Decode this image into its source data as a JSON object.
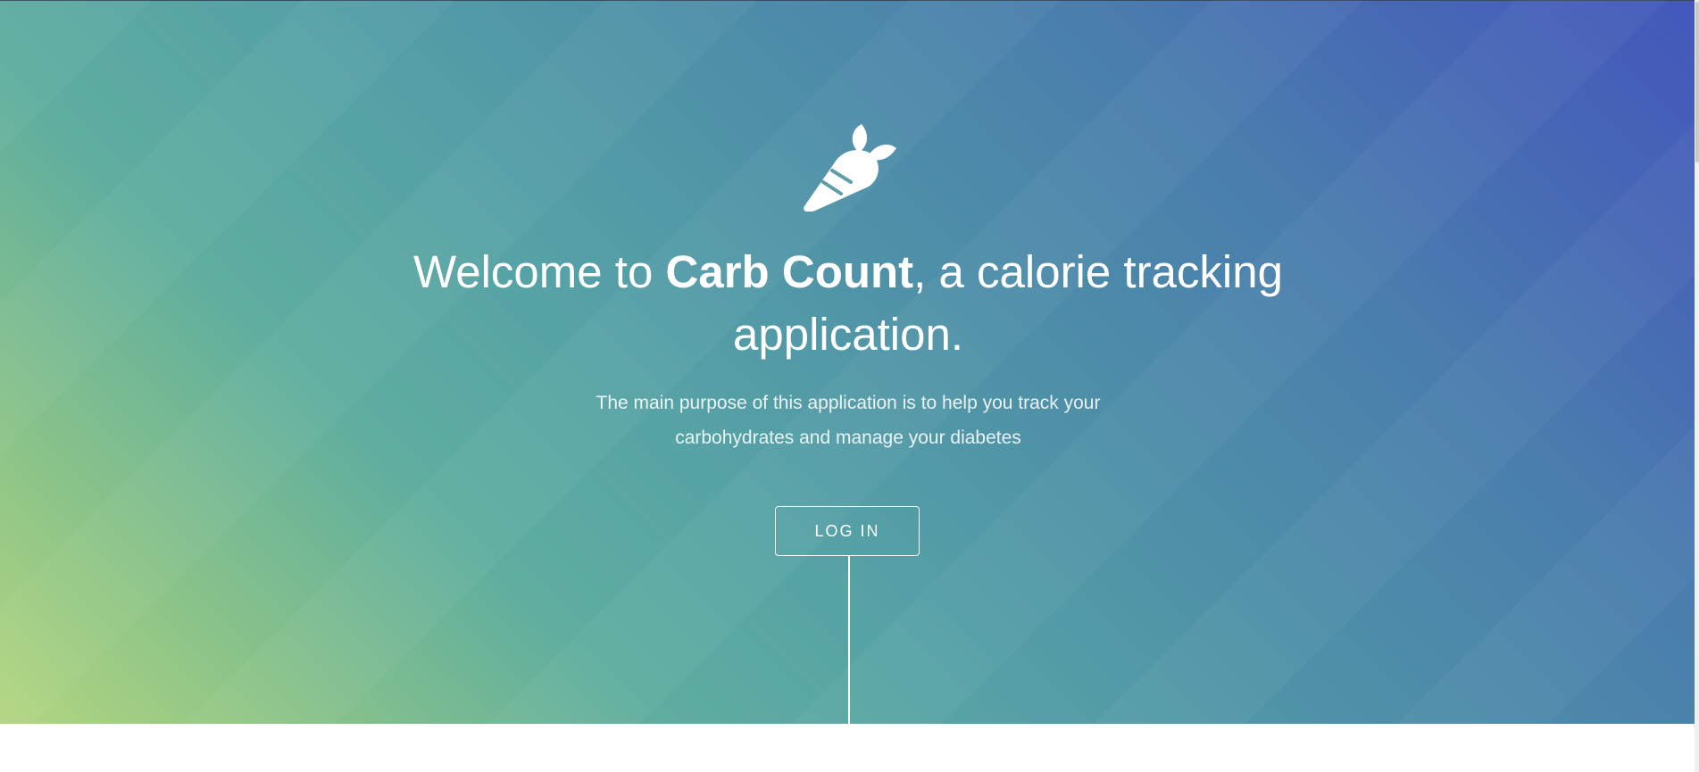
{
  "hero": {
    "logo_icon": "carrot-icon",
    "headline_prefix": "Welcome to ",
    "headline_brand": "Carb Count",
    "headline_suffix": ", a calorie tracking application.",
    "description": "The main purpose of this application is to help you track your carbohydrates and manage your diabetes",
    "login_label": "LOG IN"
  },
  "colors": {
    "gradient_start": "#b3d67f",
    "gradient_mid": "#55a1a6",
    "gradient_end": "#4358bb",
    "text": "#ffffff",
    "page_background": "#ffffff"
  }
}
